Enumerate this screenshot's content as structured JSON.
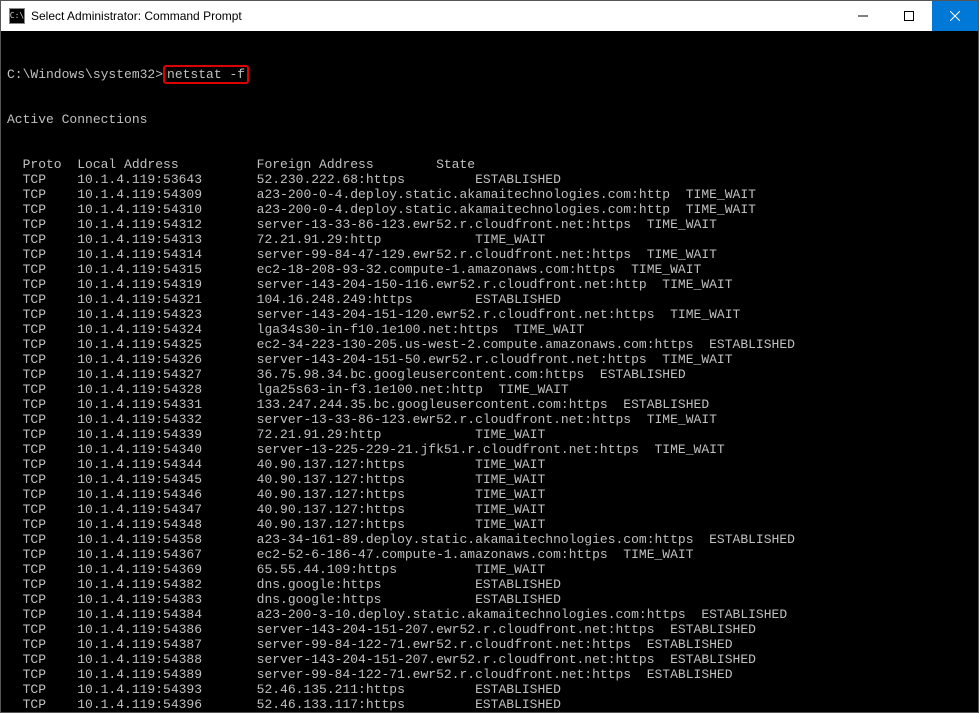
{
  "window": {
    "title": "Select Administrator: Command Prompt",
    "icon_label": "C:\\"
  },
  "prompt": {
    "path": "C:\\Windows\\system32>",
    "command": "netstat -f"
  },
  "section_title": "Active Connections",
  "headers": {
    "proto": "Proto",
    "local": "Local Address",
    "foreign": "Foreign Address",
    "state": "State"
  },
  "rows": [
    {
      "proto": "TCP",
      "local": "10.1.4.119:53643",
      "foreign": "52.230.222.68:https",
      "state": "ESTABLISHED"
    },
    {
      "proto": "TCP",
      "local": "10.1.4.119:54309",
      "foreign": "a23-200-0-4.deploy.static.akamaitechnologies.com:http",
      "state": "TIME_WAIT"
    },
    {
      "proto": "TCP",
      "local": "10.1.4.119:54310",
      "foreign": "a23-200-0-4.deploy.static.akamaitechnologies.com:http",
      "state": "TIME_WAIT"
    },
    {
      "proto": "TCP",
      "local": "10.1.4.119:54312",
      "foreign": "server-13-33-86-123.ewr52.r.cloudfront.net:https",
      "state": "TIME_WAIT"
    },
    {
      "proto": "TCP",
      "local": "10.1.4.119:54313",
      "foreign": "72.21.91.29:http",
      "state": "TIME_WAIT"
    },
    {
      "proto": "TCP",
      "local": "10.1.4.119:54314",
      "foreign": "server-99-84-47-129.ewr52.r.cloudfront.net:https",
      "state": "TIME_WAIT"
    },
    {
      "proto": "TCP",
      "local": "10.1.4.119:54315",
      "foreign": "ec2-18-208-93-32.compute-1.amazonaws.com:https",
      "state": "TIME_WAIT"
    },
    {
      "proto": "TCP",
      "local": "10.1.4.119:54319",
      "foreign": "server-143-204-150-116.ewr52.r.cloudfront.net:http",
      "state": "TIME_WAIT"
    },
    {
      "proto": "TCP",
      "local": "10.1.4.119:54321",
      "foreign": "104.16.248.249:https",
      "state": "ESTABLISHED"
    },
    {
      "proto": "TCP",
      "local": "10.1.4.119:54323",
      "foreign": "server-143-204-151-120.ewr52.r.cloudfront.net:https",
      "state": "TIME_WAIT"
    },
    {
      "proto": "TCP",
      "local": "10.1.4.119:54324",
      "foreign": "lga34s30-in-f10.1e100.net:https",
      "state": "TIME_WAIT"
    },
    {
      "proto": "TCP",
      "local": "10.1.4.119:54325",
      "foreign": "ec2-34-223-130-205.us-west-2.compute.amazonaws.com:https",
      "state": "ESTABLISHED"
    },
    {
      "proto": "TCP",
      "local": "10.1.4.119:54326",
      "foreign": "server-143-204-151-50.ewr52.r.cloudfront.net:https",
      "state": "TIME_WAIT"
    },
    {
      "proto": "TCP",
      "local": "10.1.4.119:54327",
      "foreign": "36.75.98.34.bc.googleusercontent.com:https",
      "state": "ESTABLISHED"
    },
    {
      "proto": "TCP",
      "local": "10.1.4.119:54328",
      "foreign": "lga25s63-in-f3.1e100.net:http",
      "state": "TIME_WAIT"
    },
    {
      "proto": "TCP",
      "local": "10.1.4.119:54331",
      "foreign": "133.247.244.35.bc.googleusercontent.com:https",
      "state": "ESTABLISHED"
    },
    {
      "proto": "TCP",
      "local": "10.1.4.119:54332",
      "foreign": "server-13-33-86-123.ewr52.r.cloudfront.net:https",
      "state": "TIME_WAIT"
    },
    {
      "proto": "TCP",
      "local": "10.1.4.119:54339",
      "foreign": "72.21.91.29:http",
      "state": "TIME_WAIT"
    },
    {
      "proto": "TCP",
      "local": "10.1.4.119:54340",
      "foreign": "server-13-225-229-21.jfk51.r.cloudfront.net:https",
      "state": "TIME_WAIT"
    },
    {
      "proto": "TCP",
      "local": "10.1.4.119:54344",
      "foreign": "40.90.137.127:https",
      "state": "TIME_WAIT"
    },
    {
      "proto": "TCP",
      "local": "10.1.4.119:54345",
      "foreign": "40.90.137.127:https",
      "state": "TIME_WAIT"
    },
    {
      "proto": "TCP",
      "local": "10.1.4.119:54346",
      "foreign": "40.90.137.127:https",
      "state": "TIME_WAIT"
    },
    {
      "proto": "TCP",
      "local": "10.1.4.119:54347",
      "foreign": "40.90.137.127:https",
      "state": "TIME_WAIT"
    },
    {
      "proto": "TCP",
      "local": "10.1.4.119:54348",
      "foreign": "40.90.137.127:https",
      "state": "TIME_WAIT"
    },
    {
      "proto": "TCP",
      "local": "10.1.4.119:54358",
      "foreign": "a23-34-161-89.deploy.static.akamaitechnologies.com:https",
      "state": "ESTABLISHED"
    },
    {
      "proto": "TCP",
      "local": "10.1.4.119:54367",
      "foreign": "ec2-52-6-186-47.compute-1.amazonaws.com:https",
      "state": "TIME_WAIT"
    },
    {
      "proto": "TCP",
      "local": "10.1.4.119:54369",
      "foreign": "65.55.44.109:https",
      "state": "TIME_WAIT"
    },
    {
      "proto": "TCP",
      "local": "10.1.4.119:54382",
      "foreign": "dns.google:https",
      "state": "ESTABLISHED"
    },
    {
      "proto": "TCP",
      "local": "10.1.4.119:54383",
      "foreign": "dns.google:https",
      "state": "ESTABLISHED"
    },
    {
      "proto": "TCP",
      "local": "10.1.4.119:54384",
      "foreign": "a23-200-3-10.deploy.static.akamaitechnologies.com:https",
      "state": "ESTABLISHED"
    },
    {
      "proto": "TCP",
      "local": "10.1.4.119:54386",
      "foreign": "server-143-204-151-207.ewr52.r.cloudfront.net:https",
      "state": "ESTABLISHED"
    },
    {
      "proto": "TCP",
      "local": "10.1.4.119:54387",
      "foreign": "server-99-84-122-71.ewr52.r.cloudfront.net:https",
      "state": "ESTABLISHED"
    },
    {
      "proto": "TCP",
      "local": "10.1.4.119:54388",
      "foreign": "server-143-204-151-207.ewr52.r.cloudfront.net:https",
      "state": "ESTABLISHED"
    },
    {
      "proto": "TCP",
      "local": "10.1.4.119:54389",
      "foreign": "server-99-84-122-71.ewr52.r.cloudfront.net:https",
      "state": "ESTABLISHED"
    },
    {
      "proto": "TCP",
      "local": "10.1.4.119:54393",
      "foreign": "52.46.135.211:https",
      "state": "ESTABLISHED"
    },
    {
      "proto": "TCP",
      "local": "10.1.4.119:54396",
      "foreign": "52.46.133.117:https",
      "state": "ESTABLISHED"
    }
  ]
}
